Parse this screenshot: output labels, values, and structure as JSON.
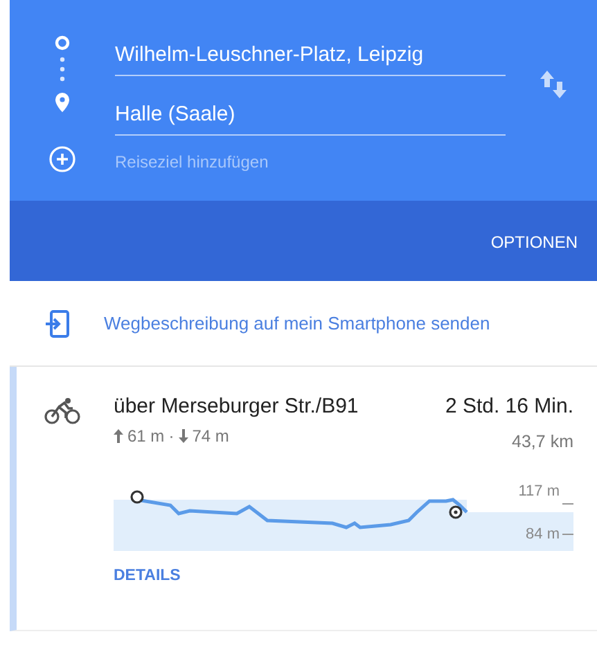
{
  "header": {
    "stops": [
      {
        "kind": "origin",
        "value": "Wilhelm-Leuschner-Platz, Leipzig"
      },
      {
        "kind": "destination",
        "value": "Halle (Saale)"
      },
      {
        "kind": "add",
        "placeholder": "Reiseziel hinzufügen"
      }
    ],
    "options_button": "OPTIONEN"
  },
  "send_link": "Wegbeschreibung auf mein Smartphone senden",
  "route": {
    "selected": true,
    "title": "über Merseburger Str./B91",
    "ascent": "61 m",
    "separator": "·",
    "descent": "74 m",
    "duration": "2 Std. 16 Min.",
    "distance": "43,7 km",
    "elevation_profile": {
      "max_label": "117 m",
      "min_label": "84 m"
    },
    "details_link": "DETAILS"
  }
}
